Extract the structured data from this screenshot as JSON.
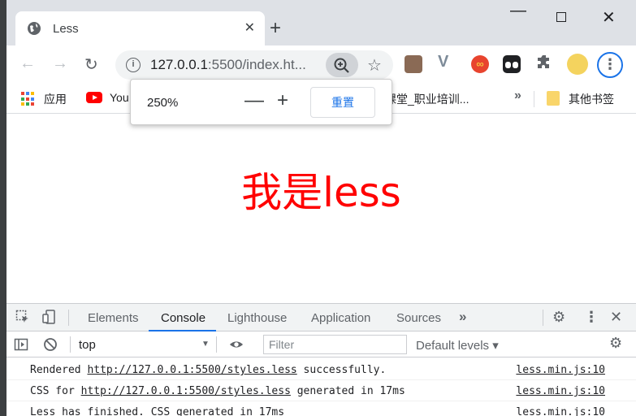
{
  "tab": {
    "title": "Less"
  },
  "address": {
    "url_host": "127.0.0.1",
    "url_rest": ":5500/index.ht..."
  },
  "zoom": {
    "level": "250%",
    "minus": "—",
    "plus": "+",
    "reset": "重置"
  },
  "bookmarks": {
    "apps": "应用",
    "youtube": "You",
    "truncated": "课堂_职业培训...",
    "more": "»",
    "other": "其他书签"
  },
  "page": {
    "heading": "我是less"
  },
  "devtools": {
    "tabs": [
      "Elements",
      "Console",
      "Lighthouse",
      "Application",
      "Sources"
    ],
    "more_tabs": "»",
    "context": "top",
    "filter_placeholder": "Filter",
    "levels": "Default levels ▾",
    "logs": [
      {
        "pre": "Rendered ",
        "link": "http://127.0.0.1:5500/styles.less",
        "post": " successfully.",
        "src": "less.min.js:10"
      },
      {
        "pre": "CSS for ",
        "link": "http://127.0.0.1:5500/styles.less",
        "post": " generated in 17ms",
        "src": "less.min.js:10"
      },
      {
        "pre": "Less has finished. CSS generated in 17ms",
        "link": "",
        "post": "",
        "src": "less.min.js:10"
      }
    ]
  },
  "icons": {
    "tab_favicon": "globe-icon",
    "back": "←",
    "forward": "→",
    "reload": "↻",
    "star": "☆",
    "puzzle": "✚",
    "menu": "⋮",
    "close": "✕",
    "new_tab": "+",
    "minimize": "—",
    "inspect": "⬚",
    "device": "▯",
    "gear": "⚙",
    "kebab": "⋮",
    "dt_close": "✕",
    "sidebar": "▸",
    "clear": "⊘",
    "eye": "👁"
  }
}
